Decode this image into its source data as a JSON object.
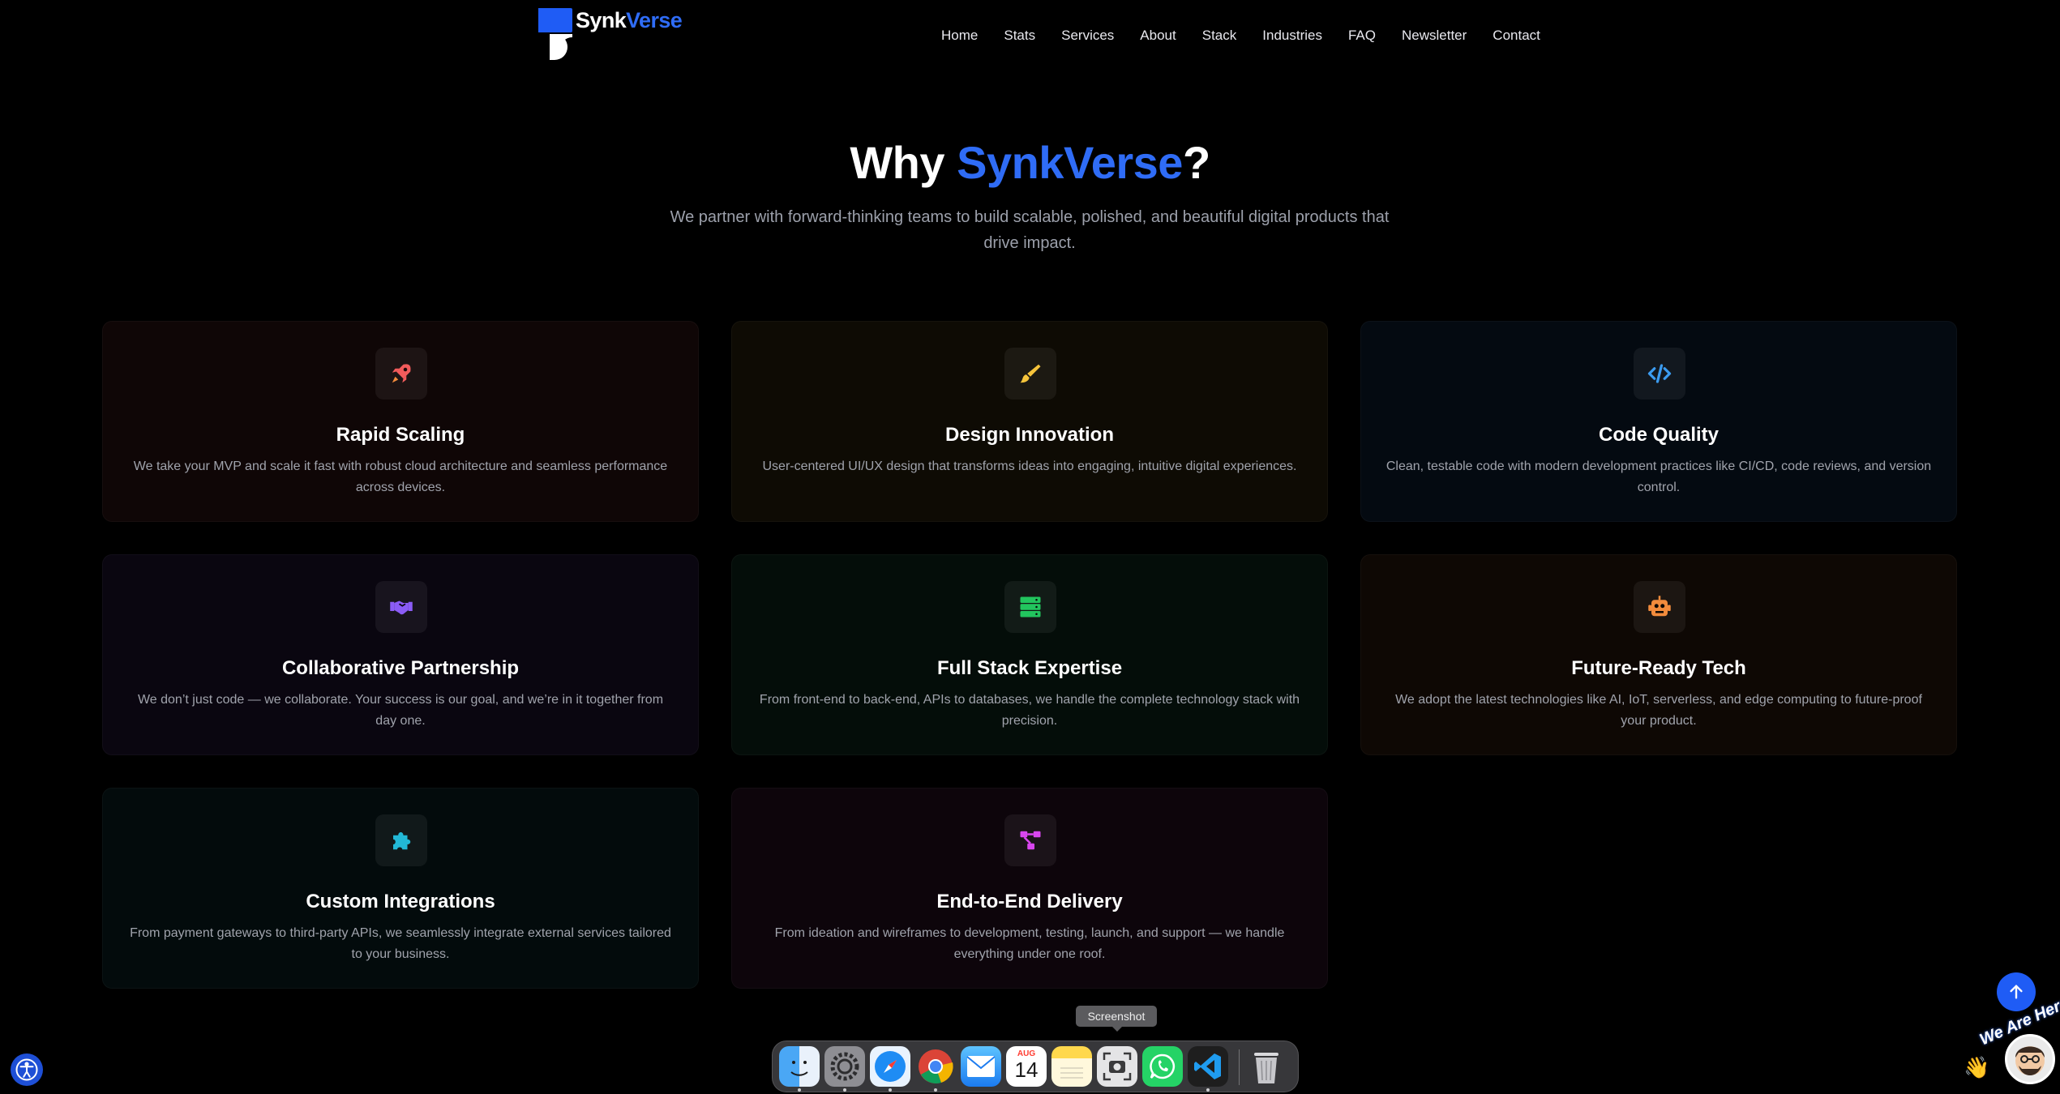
{
  "brand": {
    "name_part1": "Synk",
    "name_part2": "Verse",
    "accent_color": "#2f6cf6"
  },
  "nav": [
    {
      "label": "Home"
    },
    {
      "label": "Stats"
    },
    {
      "label": "Services"
    },
    {
      "label": "About"
    },
    {
      "label": "Stack"
    },
    {
      "label": "Industries"
    },
    {
      "label": "FAQ"
    },
    {
      "label": "Newsletter"
    },
    {
      "label": "Contact"
    }
  ],
  "hero": {
    "title_prefix": "Why ",
    "title_accent": "SynkVerse",
    "title_suffix": "?",
    "subtitle": "We partner with forward-thinking teams to build scalable, polished, and beautiful digital products that drive impact."
  },
  "cards": [
    {
      "title": "Rapid Scaling",
      "text": "We take your MVP and scale it fast with robust cloud architecture and seamless performance across devices.",
      "icon": "rocket-icon",
      "icon_color": "#f25b5b",
      "bg": "#0f0606"
    },
    {
      "title": "Design Innovation",
      "text": "User-centered UI/UX design that transforms ideas into engaging, intuitive digital experiences.",
      "icon": "paint-brush-icon",
      "icon_color": "#f6c43b",
      "bg": "#0e0b04"
    },
    {
      "title": "Code Quality",
      "text": "Clean, testable code with modern development practices like CI/CD, code reviews, and version control.",
      "icon": "code-icon",
      "icon_color": "#3b9bf0",
      "bg": "#040a11"
    },
    {
      "title": "Collaborative Partnership",
      "text": "We don’t just code — we collaborate. Your success is our goal, and we’re in it together from day one.",
      "icon": "handshake-icon",
      "icon_color": "#8b5cf6",
      "bg": "#0a0610"
    },
    {
      "title": "Full Stack Expertise",
      "text": "From front-end to back-end, APIs to databases, we handle the complete technology stack with precision.",
      "icon": "server-icon",
      "icon_color": "#22c55e",
      "bg": "#040d09"
    },
    {
      "title": "Future-Ready Tech",
      "text": "We adopt the latest technologies like AI, IoT, serverless, and edge computing to future-proof your product.",
      "icon": "robot-icon",
      "icon_color": "#f28b3c",
      "bg": "#0e0804"
    },
    {
      "title": "Custom Integrations",
      "text": "From payment gateways to third-party APIs, we seamlessly integrate external services tailored to your business.",
      "icon": "puzzle-icon",
      "icon_color": "#22b8d6",
      "bg": "#030b0c"
    },
    {
      "title": "End-to-End Delivery",
      "text": "From ideation and wireframes to development, testing, launch, and support — we handle everything under one roof.",
      "icon": "workflow-icon",
      "icon_color": "#d946ef",
      "bg": "#0d050b"
    }
  ],
  "widgets": {
    "we_are_here": "We Are Here!",
    "scroll_top_icon": "arrow-up-icon",
    "accessibility_icon": "accessibility-icon"
  },
  "dock": {
    "tooltip": "Screenshot",
    "calendar_month": "AUG",
    "calendar_day": "14",
    "apps": [
      {
        "name": "finder-icon",
        "running": true
      },
      {
        "name": "system-settings-icon",
        "running": true
      },
      {
        "name": "safari-icon",
        "running": true
      },
      {
        "name": "chrome-icon",
        "running": true
      },
      {
        "name": "mail-icon",
        "running": false
      },
      {
        "name": "calendar-icon",
        "running": false
      },
      {
        "name": "notes-icon",
        "running": false
      },
      {
        "name": "screenshot-icon",
        "running": false
      },
      {
        "name": "whatsapp-icon",
        "running": false
      },
      {
        "name": "vscode-icon",
        "running": true
      },
      {
        "name": "trash-icon",
        "running": false
      }
    ]
  }
}
